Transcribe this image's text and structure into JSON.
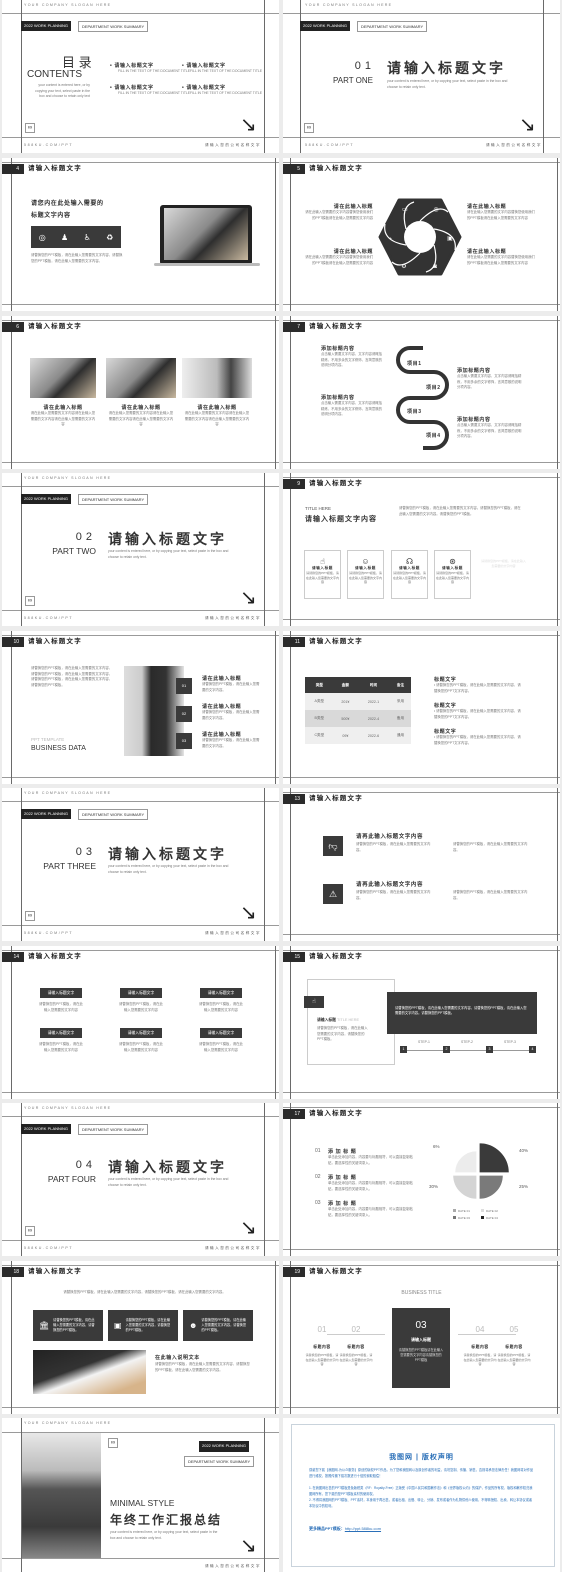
{
  "common": {
    "slogan": "YOUR COMPANY SLOGAN HERE",
    "footer_site": "588KU.COM/PPT",
    "footer_right": "请输入您的公司名称文字",
    "tag_dark": "2022 WORK PLANNING",
    "tag_outline": "DEPARTMENT WORK SUMMARY",
    "slide_title": "请输入标题文字",
    "en_lorem": "your content is entered here, or by copying your text, select paste in the box and choose to retain only text.",
    "cn_lorem": "请替换您的PPT模板，请在此输入您需要的文字内容。",
    "cn_lorem2": "请在此输入您需要的文字内容，使用我们的PPT模板",
    "chain_icon": "∞",
    "arrow_icon": "↘"
  },
  "s1": {
    "title_cn": "目 录",
    "title_en": "CONTENTS",
    "desc": "your content is entered here, or by copying your text, select paste in the box and choose to retain only text",
    "items": [
      {
        "label": "请输入标题文字",
        "sub": "FILL IN THE TEXT OF THE DOCUMENT TITLE"
      },
      {
        "label": "请输入标题文字",
        "sub": "FILL IN THE TEXT OF THE DOCUMENT TITLE"
      },
      {
        "label": "请输入标题文字",
        "sub": "FILL IN THE TEXT OF THE DOCUMENT TITLE"
      },
      {
        "label": "请输入标题文字",
        "sub": "FILL IN THE TEXT OF THE DOCUMENT TITLE"
      }
    ]
  },
  "sections": [
    {
      "num": "01",
      "part": "PART ONE",
      "title": "请输入标题文字"
    },
    {
      "num": "02",
      "part": "PART TWO",
      "title": "请输入标题文字"
    },
    {
      "num": "03",
      "part": "PART THREE",
      "title": "请输入标题文字"
    },
    {
      "num": "04",
      "part": "PART FOUR",
      "title": "请输入标题文字"
    }
  ],
  "s4": {
    "num": "4",
    "heading1": "请您内在此处输入需要的",
    "heading2": "标题文字内容",
    "body": "请替换您的PPT模板，请在此输入您需要的文字内容，请替换您的PPT模板，请在此输入您需要的文字内容。",
    "icons": [
      "target-icon",
      "user-icon",
      "accessibility-icon",
      "recycle-icon"
    ]
  },
  "s5": {
    "num": "5",
    "item_title": "请在此输入标题",
    "item_body": "请在此输入您需要的文字内容替换您使用我们的PPT模板请在此输入您需要的文字内容"
  },
  "s6": {
    "num": "6",
    "item_title": "请在此输入标题",
    "item_body": "请在此输入您需要的文字内容请在此输入您需要的文字内容请在此输入您需要的文字内容"
  },
  "s7": {
    "num": "7",
    "item_title": "添加标题内容",
    "item_body": "点击输入需要文字内容，文字内容请概括精炼，不用多余的文字修饰，言简意赅的说明分项内容。",
    "items": [
      "项目1",
      "项目2",
      "项目3",
      "项目4"
    ]
  },
  "s9": {
    "num": "9",
    "kicker": "TITLE HERE",
    "heading": "请输入标题文字内容",
    "intro": "请替换您的PPT模板，请在此输入您需要的文字内容。请替换您的PPT模板，请在此输入您需要的文字内容。请替换您的PPT模板。",
    "card_title": "请输入标题",
    "card_body": "请替换您的PPT模板，请在此输入您需要的文字内容"
  },
  "s10": {
    "num": "10",
    "body": "请替换您的PPT模板，请在此输入您需要的文字内容，请替换您的PPT模板，请在此输入您需要的文字内容，请替换您的PPT模板，请在此输入您需要的文字内容，请替换您的PPT模板。",
    "kicker": "PPT TEMPLATE",
    "heading": "BUSINESS DATA",
    "item_title": "请在此输入标题",
    "item_body": "请替换您的PPT模板，请在此输入您需要的文字内容。",
    "nums": [
      "01",
      "02",
      "03"
    ]
  },
  "s11": {
    "num": "11",
    "headers": [
      "类型",
      "金额",
      "时间",
      "备注"
    ],
    "rows": [
      [
        "A类型",
        "201¥",
        "2022-1",
        "采用"
      ],
      [
        "B类型",
        "500¥",
        "2022-4",
        "备用"
      ],
      [
        "C类型",
        "09¥",
        "2022-6",
        "通用"
      ]
    ],
    "note_title": "标题文字",
    "note_body": "请替换您的PPT模板，请在此输入您需要的文字内容，请替换您的PPT文字内容。"
  },
  "s13": {
    "num": "13",
    "heading": "请再此输入标题文字内容",
    "body": "请替换您的PPT模板，请在此输入您需要的文字内容。"
  },
  "s14": {
    "num": "14",
    "label": "请输入标题文字",
    "body": "请替换您的PPT模板，请在此输入您需要的文字内容"
  },
  "s15": {
    "num": "15",
    "card_title": "请输入标题",
    "card_kicker": "TITLE HERE",
    "card_body": "请替换您的PPT模板，请在此输入您需要的文字内容，请替换您的PPT模板。",
    "dark_body": "请替换您的PPT模板，请在此输入您需要的文字内容。请替换您的PPT模板，请在此输入您需要的文字内容。请替换您的PPT模板。",
    "steps": [
      "STEP-1",
      "STEP-2",
      "STEP-3"
    ],
    "step_nums": [
      "1",
      "2",
      "3",
      "4"
    ]
  },
  "s17": {
    "num": "17",
    "items": [
      {
        "n": "01",
        "title": "添 加 标 题"
      },
      {
        "n": "02",
        "title": "添 加 标 题"
      },
      {
        "n": "03",
        "title": "添 加 标 题"
      }
    ],
    "item_body": "单击此处添加内容，内容要与标题相符，可以直接复制粘贴，要选择性的关键词录入。",
    "pie": [
      {
        "label": "40%",
        "value": 40,
        "color": "#3a3a3a"
      },
      {
        "label": "25%",
        "value": 25,
        "color": "#7a7a7a"
      },
      {
        "label": "30%",
        "value": 30,
        "color": "#d4d4d4"
      },
      {
        "label": "6%",
        "value": 6,
        "color": "#ececec"
      }
    ],
    "legend": [
      "DATE 01",
      "DATE 02",
      "DATE 03",
      "DATE 04"
    ]
  },
  "s18": {
    "num": "18",
    "intro": "请替换您的PPT模板，请在此输入您需要的文字内容，请替换您的PPT模板，请在此输入您需要的文字内容。",
    "box_body": "请替换您的PPT模板，请在此输入您需要的文字内容，请替换您的PPT模板。",
    "heading": "在此输入说明文本",
    "body": "请替换您的PPT模板，请在此输入您需要的文字内容，请替换您的PPT模板，请在此输入您需要的文字内容。"
  },
  "s19": {
    "num": "19",
    "title": "BUSINESS TITLE",
    "steps": [
      "01",
      "02",
      "04",
      "05"
    ],
    "center_num": "03",
    "center_title": "请输入标题",
    "center_body": "请替换您的PPT模板请在此输入您需要的文字内容请替换您的PPT模板",
    "step_title": "标题内容",
    "step_body": "请替换您的PPT模板，请在此输入您需要的文字内容"
  },
  "cover": {
    "kicker": "MINIMAL STYLE",
    "title": "年终工作汇报总结",
    "desc": "your content is entered here, or by copying your text, select paste in the box and choose to retain only text."
  },
  "copyright": {
    "title": "我图网 | 版权声明",
    "p1": "感谢您下载【我图网-为公众服务】原创的版权PPT作品，为了您和我图网以及原创作者的利益，请勿复制、传播、销售，否则将承担法律责任！我图网将对作品进行维权，按照传播下载次数进行十倍的索取赔偿！",
    "p2": "1. 在我图网出售的PPT模板是免版税类（RF：Royalty-Free）正版受《中国人民共和国著作法》和《世界版权公约》的保护，作品的所有权、版权和著作权归我图网所有，您下载的是PPT模板素材的使用权。",
    "p3": "2. 不得将我图网的PPT模板、PPT素材，本身用于再出售，或者出租、出借、转让、分销、发布或者作为礼物供他人使用，不得转授权、出卖、转让本协议或者本协议中的权利。",
    "link_label": "更多精品PPT模板：",
    "link": "http://ppt.588ku.com",
    "color": "#2a6fb8"
  }
}
